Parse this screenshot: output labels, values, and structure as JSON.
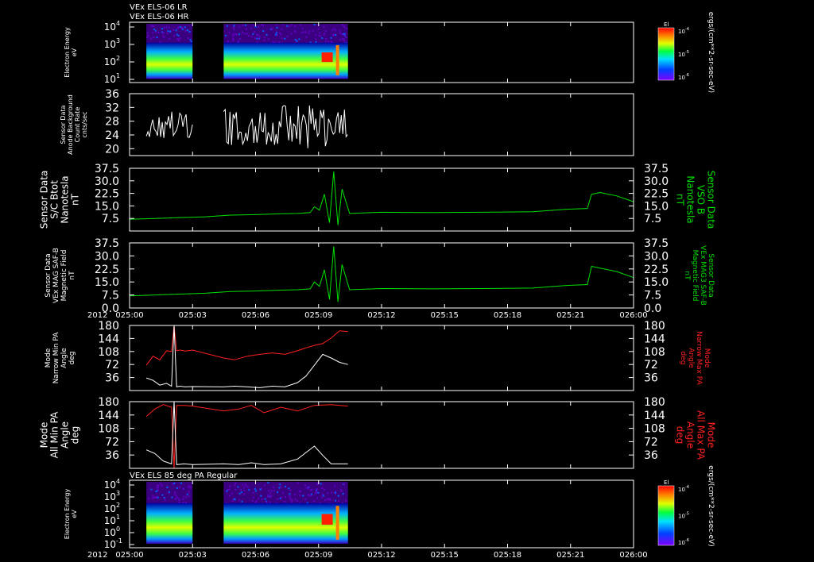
{
  "header": {
    "line1": "VEx ELS-06 LR",
    "line2": "VEx ELS-06 HR"
  },
  "year_label": "2012",
  "colors": {
    "background": "#000000",
    "axis": "#ffffff",
    "green": "#00e000",
    "red": "#ff2020",
    "white": "#ffffff"
  },
  "time_axis": {
    "start_min": 0,
    "end_min": 60,
    "tick_labels": [
      "025:00",
      "025:03",
      "025:06",
      "025:09",
      "025:12",
      "025:15",
      "025:18",
      "025:21",
      "026:00"
    ]
  },
  "chart_data": [
    {
      "type": "heatmap",
      "title": "Electron Energy eV",
      "ylabel": [
        "Electron Energy",
        "eV"
      ],
      "y_tick_labels": [
        "10^4",
        "10^3",
        "10^2",
        "10^1"
      ],
      "right_label": "ergs/(cm**2-sr-sec-eV)",
      "colorbar": {
        "title": "El",
        "ticks": [
          "10^-4",
          "10^-5",
          "10^-6"
        ],
        "scale": "log"
      },
      "data_segments_min": [
        [
          2.0,
          7.5
        ],
        [
          11.2,
          26.0
        ]
      ],
      "features": "broad green/yellow band with red enhancement near 025:07-025:08"
    },
    {
      "type": "line",
      "ylabel": [
        "Sensor Data",
        "Anode Background",
        "Count Rate",
        "cnts/sec"
      ],
      "yticks": [
        20,
        24,
        28,
        32,
        36
      ],
      "ylim": [
        18,
        36
      ],
      "series": [
        {
          "color": "white",
          "segments": [
            {
              "x": [
                2.0,
                7.5
              ],
              "y_min": 23,
              "y_max": 31
            },
            {
              "x": [
                11.2,
                26.0
              ],
              "y_min": 20,
              "y_max": 33
            }
          ]
        }
      ]
    },
    {
      "type": "line",
      "ylabel": [
        "Sensor Data",
        "S/C Btot",
        "Nanotesla",
        "nT"
      ],
      "ylabel_right": [
        "Sensor Data",
        "VSO B",
        "Nanotesla",
        "nT"
      ],
      "yticks": [
        7.5,
        15.0,
        22.5,
        30.0,
        37.5
      ],
      "ylim": [
        0,
        37.5
      ],
      "series": [
        {
          "color": "green",
          "x": [
            0,
            3,
            6,
            9,
            12,
            15,
            18,
            20,
            21.5,
            22,
            22.6,
            23.2,
            23.8,
            24.3,
            24.8,
            25.3,
            26.2,
            30,
            36,
            42,
            48,
            52,
            54.5,
            55,
            56,
            58,
            60
          ],
          "y": [
            7.0,
            7.5,
            8.0,
            8.5,
            9.5,
            9.8,
            10.3,
            10.5,
            11.0,
            14.5,
            12.5,
            22.0,
            5.0,
            35.5,
            3.5,
            25.0,
            10.5,
            11.2,
            11.0,
            11.2,
            11.5,
            13.0,
            13.5,
            22.0,
            23.0,
            21.0,
            17.5
          ]
        }
      ]
    },
    {
      "type": "line",
      "ylabel": [
        "Sensor Data",
        "VEx MAG SAF-B",
        "Magnetic Field",
        "nT"
      ],
      "ylabel_right": [
        "Sensor Data",
        "VEx MAG3 SAF-B",
        "Magnetic Field",
        "nT"
      ],
      "yticks": [
        0.0,
        7.5,
        15.0,
        22.5,
        30.0,
        37.5
      ],
      "ylim": [
        0,
        37.5
      ],
      "series": [
        {
          "color": "green",
          "x": [
            0,
            3,
            6,
            9,
            12,
            15,
            18,
            20,
            21.5,
            22,
            22.6,
            23.2,
            23.8,
            24.3,
            24.8,
            25.3,
            26.2,
            30,
            36,
            42,
            48,
            52,
            54.5,
            55,
            56,
            58,
            60
          ],
          "y": [
            7.0,
            7.5,
            8.0,
            8.5,
            9.5,
            9.8,
            10.3,
            10.5,
            11.0,
            15.0,
            12.5,
            22.0,
            5.0,
            35.5,
            3.5,
            25.0,
            10.5,
            11.2,
            11.0,
            11.2,
            11.5,
            13.0,
            13.5,
            24.0,
            23.0,
            21.0,
            17.5
          ]
        }
      ]
    },
    {
      "type": "line",
      "ylabel": [
        "Mode",
        "Narrow Min PA",
        "Angle",
        "deg"
      ],
      "ylabel_right": [
        "Mode",
        "Narrow Max PA",
        "Angle",
        "deg"
      ],
      "yticks": [
        36,
        72,
        108,
        144,
        180
      ],
      "ylim": [
        0,
        180
      ],
      "series": [
        {
          "color": "red",
          "x": [
            2.0,
            2.8,
            3.6,
            4.4,
            5.0,
            5.3,
            5.6,
            6.0,
            6.6,
            7.5,
            11.2,
            12.5,
            14.0,
            15.5,
            17.0,
            18.5,
            20.0,
            21.0,
            22.0,
            23.0,
            24.0,
            25.0,
            26.0
          ],
          "y": [
            70,
            95,
            85,
            110,
            108,
            180,
            110,
            112,
            109,
            112,
            90,
            85,
            95,
            100,
            104,
            100,
            110,
            118,
            125,
            130,
            145,
            165,
            163
          ]
        },
        {
          "color": "white",
          "x": [
            2.0,
            2.8,
            3.6,
            4.4,
            5.0,
            5.3,
            5.6,
            6.0,
            6.6,
            7.5,
            11.2,
            12.5,
            14.0,
            15.5,
            17.0,
            18.5,
            20.0,
            21.0,
            22.0,
            23.0,
            24.0,
            25.0,
            26.0
          ],
          "y": [
            35,
            28,
            15,
            20,
            12,
            180,
            10,
            12,
            10,
            11,
            10,
            12,
            10,
            8,
            12,
            10,
            22,
            40,
            70,
            100,
            90,
            78,
            72
          ]
        }
      ]
    },
    {
      "type": "line",
      "ylabel": [
        "Mode",
        "All Min PA",
        "Angle",
        "deg"
      ],
      "ylabel_right": [
        "Mode",
        "All Max PA",
        "Angle",
        "deg"
      ],
      "yticks": [
        36,
        72,
        108,
        144,
        180
      ],
      "ylim": [
        0,
        180
      ],
      "series": [
        {
          "color": "red",
          "x": [
            2.0,
            3.0,
            4.0,
            5.0,
            5.3,
            5.6,
            6.5,
            7.5,
            11.2,
            13.0,
            14.5,
            16.0,
            18.0,
            20.0,
            22.0,
            24.0,
            26.0
          ],
          "y": [
            140,
            160,
            172,
            165,
            0,
            170,
            170,
            168,
            155,
            160,
            170,
            150,
            165,
            155,
            170,
            172,
            168
          ]
        },
        {
          "color": "white",
          "x": [
            2.0,
            3.0,
            4.0,
            5.0,
            5.3,
            5.6,
            6.5,
            7.5,
            11.2,
            13.0,
            14.5,
            16.0,
            18.0,
            20.0,
            22.0,
            23.0,
            24.0,
            26.0
          ],
          "y": [
            50,
            40,
            20,
            12,
            180,
            10,
            12,
            10,
            12,
            10,
            15,
            10,
            12,
            25,
            60,
            35,
            12,
            12
          ]
        }
      ]
    },
    {
      "type": "heatmap",
      "title": "VEx ELS 85 deg PA Regular",
      "ylabel": [
        "Electron Energy",
        "eV"
      ],
      "y_tick_labels": [
        "10^4",
        "10^3",
        "10^2",
        "10^1",
        "10^0",
        "10^-1"
      ],
      "right_label": "ergs/(cm**2-sr-sec-eV)",
      "colorbar": {
        "title": "El",
        "ticks": [
          "10^-4",
          "10^-5",
          "10^-6"
        ],
        "scale": "log"
      },
      "data_segments_min": [
        [
          2.0,
          7.5
        ],
        [
          11.2,
          26.0
        ]
      ],
      "features": "green/yellow band with red enhancement near 025:07-025:08"
    }
  ]
}
